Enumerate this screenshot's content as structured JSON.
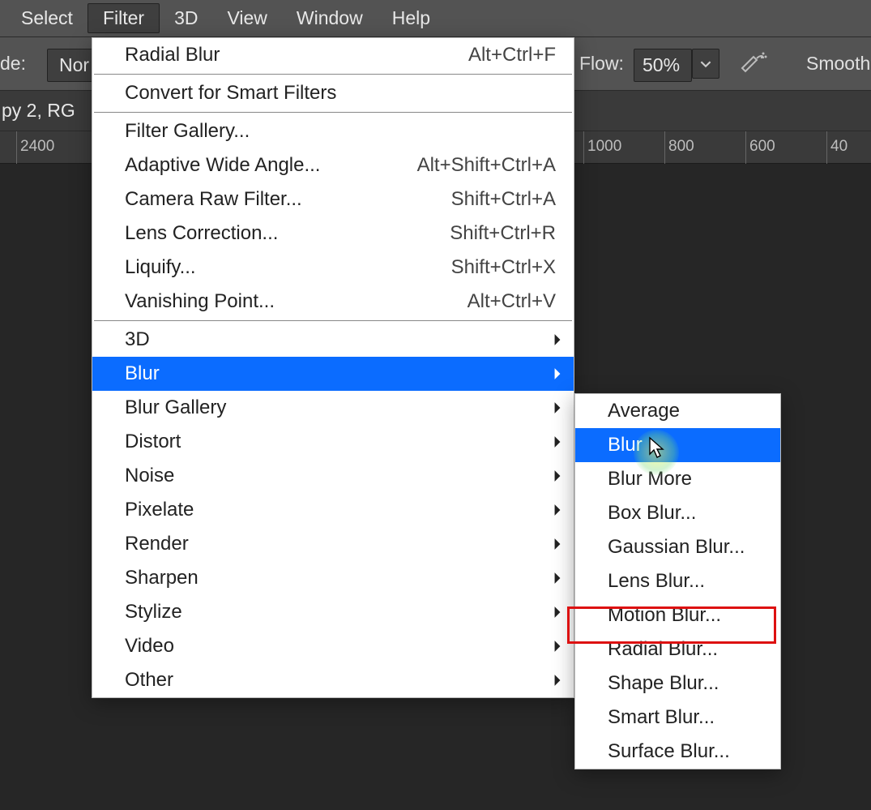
{
  "menubar": {
    "items": [
      "Select",
      "Filter",
      "3D",
      "View",
      "Window",
      "Help"
    ],
    "active_index": 1
  },
  "options": {
    "mode_label": "de:",
    "mode_value": "Nor",
    "flow_label": "Flow:",
    "flow_value": "50%",
    "smoothing_label": "Smooth"
  },
  "tab": {
    "label": "py 2, RG"
  },
  "ruler": {
    "ticks": [
      {
        "pos": 20,
        "label": "2400"
      },
      {
        "pos": 720,
        "label": "1000"
      },
      {
        "pos": 820,
        "label": "800"
      },
      {
        "pos": 920,
        "label": "600"
      },
      {
        "pos": 1020,
        "label": "40"
      }
    ]
  },
  "filter_menu": {
    "groups": [
      [
        {
          "label": "Radial Blur",
          "shortcut": "Alt+Ctrl+F"
        }
      ],
      [
        {
          "label": "Convert for Smart Filters"
        }
      ],
      [
        {
          "label": "Filter Gallery..."
        },
        {
          "label": "Adaptive Wide Angle...",
          "shortcut": "Alt+Shift+Ctrl+A"
        },
        {
          "label": "Camera Raw Filter...",
          "shortcut": "Shift+Ctrl+A"
        },
        {
          "label": "Lens Correction...",
          "shortcut": "Shift+Ctrl+R"
        },
        {
          "label": "Liquify...",
          "shortcut": "Shift+Ctrl+X"
        },
        {
          "label": "Vanishing Point...",
          "shortcut": "Alt+Ctrl+V"
        }
      ],
      [
        {
          "label": "3D",
          "submenu": true
        },
        {
          "label": "Blur",
          "submenu": true,
          "selected": true
        },
        {
          "label": "Blur Gallery",
          "submenu": true
        },
        {
          "label": "Distort",
          "submenu": true
        },
        {
          "label": "Noise",
          "submenu": true
        },
        {
          "label": "Pixelate",
          "submenu": true
        },
        {
          "label": "Render",
          "submenu": true
        },
        {
          "label": "Sharpen",
          "submenu": true
        },
        {
          "label": "Stylize",
          "submenu": true
        },
        {
          "label": "Video",
          "submenu": true
        },
        {
          "label": "Other",
          "submenu": true
        }
      ]
    ]
  },
  "blur_submenu": {
    "items": [
      {
        "label": "Average"
      },
      {
        "label": "Blur",
        "selected": true
      },
      {
        "label": "Blur More"
      },
      {
        "label": "Box Blur..."
      },
      {
        "label": "Gaussian Blur..."
      },
      {
        "label": "Lens Blur..."
      },
      {
        "label": "Motion Blur...",
        "highlighted": true
      },
      {
        "label": "Radial Blur..."
      },
      {
        "label": "Shape Blur..."
      },
      {
        "label": "Smart Blur..."
      },
      {
        "label": "Surface Blur..."
      }
    ]
  }
}
